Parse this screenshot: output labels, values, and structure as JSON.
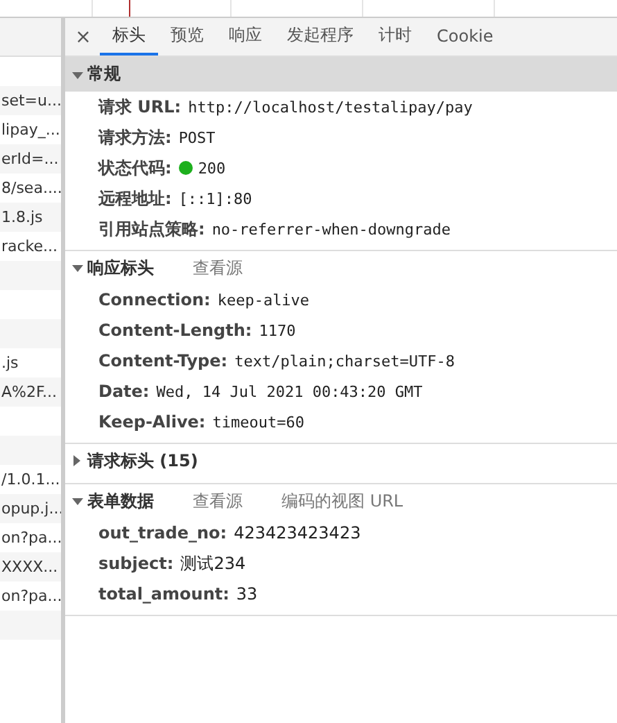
{
  "request_groups": [
    {
      "items": [
        {
          "text": "set=u..."
        },
        {
          "text": "lipay_..."
        },
        {
          "text": "erId=..."
        },
        {
          "text": "8/sea...."
        },
        {
          "text": "1.8.js"
        },
        {
          "text": "racke..."
        }
      ]
    },
    {
      "items": [
        {
          "text": ".js"
        },
        {
          "text": "A%2F..."
        }
      ]
    },
    {
      "items": [
        {
          "text": "/1.0.1..."
        },
        {
          "text": "opup.j..."
        },
        {
          "text": "on?pa..."
        },
        {
          "text": "XXXX..."
        },
        {
          "text": "on?pa..."
        }
      ]
    }
  ],
  "close_label": "×",
  "tabs": [
    {
      "label": "标头",
      "selected": true
    },
    {
      "label": "预览",
      "selected": false
    },
    {
      "label": "响应",
      "selected": false
    },
    {
      "label": "发起程序",
      "selected": false
    },
    {
      "label": "计时",
      "selected": false
    },
    {
      "label": "Cookie",
      "selected": false
    }
  ],
  "sections": [
    {
      "title": "常规",
      "expanded": true,
      "highlighted": true,
      "rows": [
        {
          "name": "请求 URL:",
          "value": "http://localhost/testalipay/pay",
          "kind": "mono"
        },
        {
          "name": "请求方法:",
          "value": "POST",
          "kind": "mono"
        },
        {
          "name": "状态代码:",
          "value": "200",
          "kind": "status",
          "color": "#1db01d"
        },
        {
          "name": "远程地址:",
          "value": "[::1]:80",
          "kind": "mono"
        },
        {
          "name": "引用站点策略:",
          "value": "no-referrer-when-downgrade",
          "kind": "mono"
        }
      ]
    },
    {
      "title": "响应标头",
      "expanded": true,
      "highlighted": false,
      "links": [
        "查看源"
      ],
      "rows": [
        {
          "name": "Connection:",
          "value": "keep-alive",
          "kind": "mono"
        },
        {
          "name": "Content-Length:",
          "value": "1170",
          "kind": "mono"
        },
        {
          "name": "Content-Type:",
          "value": "text/plain;charset=UTF-8",
          "kind": "mono"
        },
        {
          "name": "Date:",
          "value": "Wed, 14 Jul 2021 00:43:20 GMT",
          "kind": "mono"
        },
        {
          "name": "Keep-Alive:",
          "value": "timeout=60",
          "kind": "mono"
        }
      ]
    },
    {
      "title": "请求标头 (15)",
      "expanded": false,
      "highlighted": false
    },
    {
      "title": "表单数据",
      "expanded": true,
      "highlighted": false,
      "links": [
        "查看源",
        "编码的视图 URL"
      ],
      "rows": [
        {
          "name": "out_trade_no:",
          "value": "423423423423",
          "kind": "plain"
        },
        {
          "name": "subject:",
          "value": "测试234",
          "kind": "plain"
        },
        {
          "name": "total_amount:",
          "value": "33",
          "kind": "plain"
        }
      ]
    }
  ]
}
